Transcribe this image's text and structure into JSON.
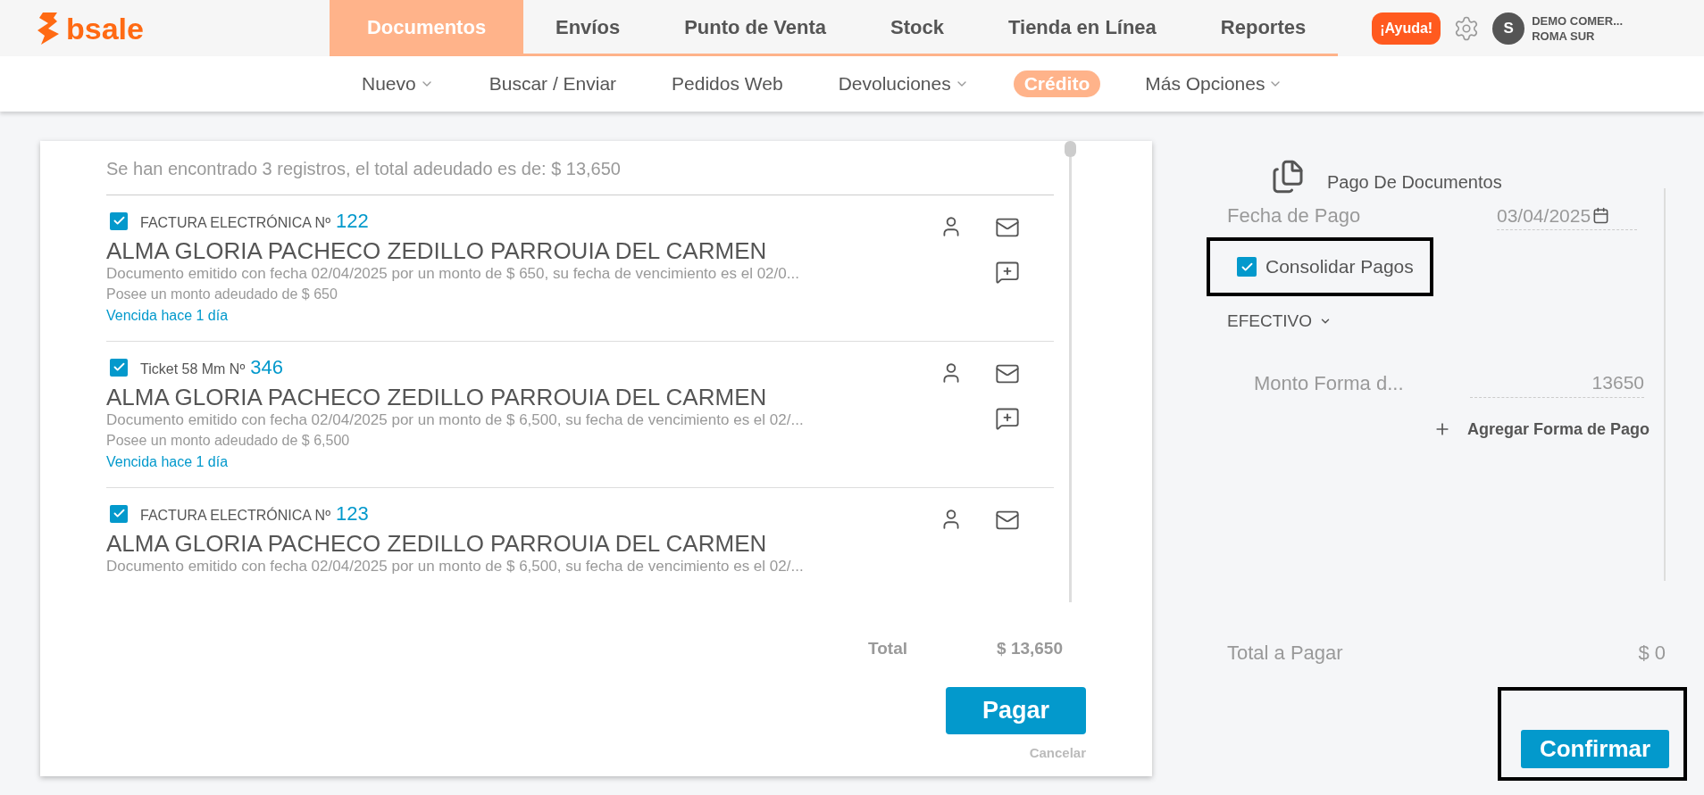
{
  "brand": {
    "name": "bsale"
  },
  "main_nav": [
    {
      "label": "Documentos",
      "selected": true
    },
    {
      "label": "Envíos",
      "selected": false
    },
    {
      "label": "Punto de Venta",
      "selected": false
    },
    {
      "label": "Stock",
      "selected": false
    },
    {
      "label": "Tienda en Línea",
      "selected": false
    },
    {
      "label": "Reportes",
      "selected": false
    }
  ],
  "help_button": "¡Ayuda!",
  "user": {
    "initial": "S",
    "company": "DEMO COMER...",
    "branch": "ROMA SUR"
  },
  "sub_nav": [
    {
      "label": "Nuevo",
      "dropdown": true,
      "selected": false
    },
    {
      "label": "Buscar / Enviar",
      "dropdown": false,
      "selected": false
    },
    {
      "label": "Pedidos Web",
      "dropdown": false,
      "selected": false
    },
    {
      "label": "Devoluciones",
      "dropdown": true,
      "selected": false
    },
    {
      "label": "Crédito",
      "dropdown": false,
      "selected": true
    },
    {
      "label": "Más Opciones",
      "dropdown": true,
      "selected": false
    }
  ],
  "summary": "Se han encontrado 3 registros, el total adeudado es de: $ 13,650",
  "documents": [
    {
      "checked": true,
      "type": "FACTURA ELECTRÓNICA Nº",
      "number": "122",
      "customer": "ALMA GLORIA PACHECO ZEDILLO PARROUIA DEL CARMEN",
      "description": "Documento emitido con fecha 02/04/2025 por un monto de $ 650, su fecha de vencimiento es el 02/0...",
      "debt": "Posee un monto adeudado de $ 650",
      "status": "Vencida hace 1 día",
      "comment_action": true
    },
    {
      "checked": true,
      "type": "Ticket 58 Mm Nº",
      "number": "346",
      "customer": "ALMA GLORIA PACHECO ZEDILLO PARROUIA DEL CARMEN",
      "description": "Documento emitido con fecha 02/04/2025 por un monto de $ 6,500, su fecha de vencimiento es el 02/...",
      "debt": "Posee un monto adeudado de $ 6,500",
      "status": "Vencida hace 1 día",
      "comment_action": true
    },
    {
      "checked": true,
      "type": "FACTURA ELECTRÓNICA Nº",
      "number": "123",
      "customer": "ALMA GLORIA PACHECO ZEDILLO PARROUIA DEL CARMEN",
      "description": "Documento emitido con fecha 02/04/2025 por un monto de $ 6,500, su fecha de vencimiento es el 02/...",
      "comment_action": false
    }
  ],
  "total": {
    "label": "Total",
    "value": "$ 13,650"
  },
  "pay_button": "Pagar",
  "cancel_link": "Cancelar",
  "payment": {
    "title": "Pago De Documentos",
    "date_label": "Fecha de Pago",
    "date": "03/04/2025",
    "consolidate": {
      "label": "Consolidar Pagos",
      "checked": true
    },
    "method": "EFECTIVO",
    "amount_label": "Monto Forma d...",
    "amount": "13650",
    "add_method": "Agregar Forma de Pago",
    "total_label": "Total a Pagar",
    "total": "$ 0",
    "confirm": "Confirmar"
  }
}
